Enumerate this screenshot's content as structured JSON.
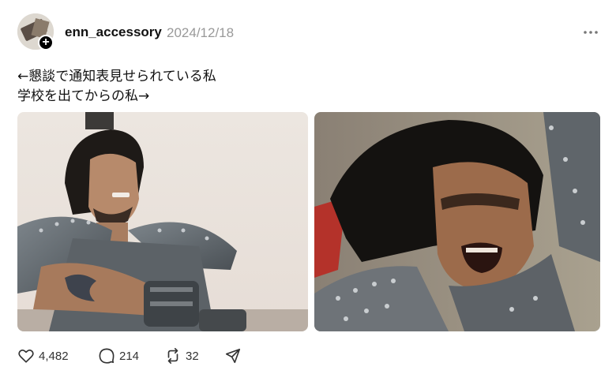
{
  "post": {
    "username": "enn_accessory",
    "timestamp": "2024/12/18",
    "caption_line1": "←懇談で通知表見せられている私",
    "caption_line2": "学校を出てからの私→"
  },
  "actions": {
    "likes": "4,482",
    "replies": "214",
    "reposts": "32"
  },
  "icons": {
    "follow": "plus-icon",
    "menu": "more-icon",
    "like": "heart-icon",
    "reply": "comment-icon",
    "repost": "repost-icon",
    "share": "share-icon"
  }
}
